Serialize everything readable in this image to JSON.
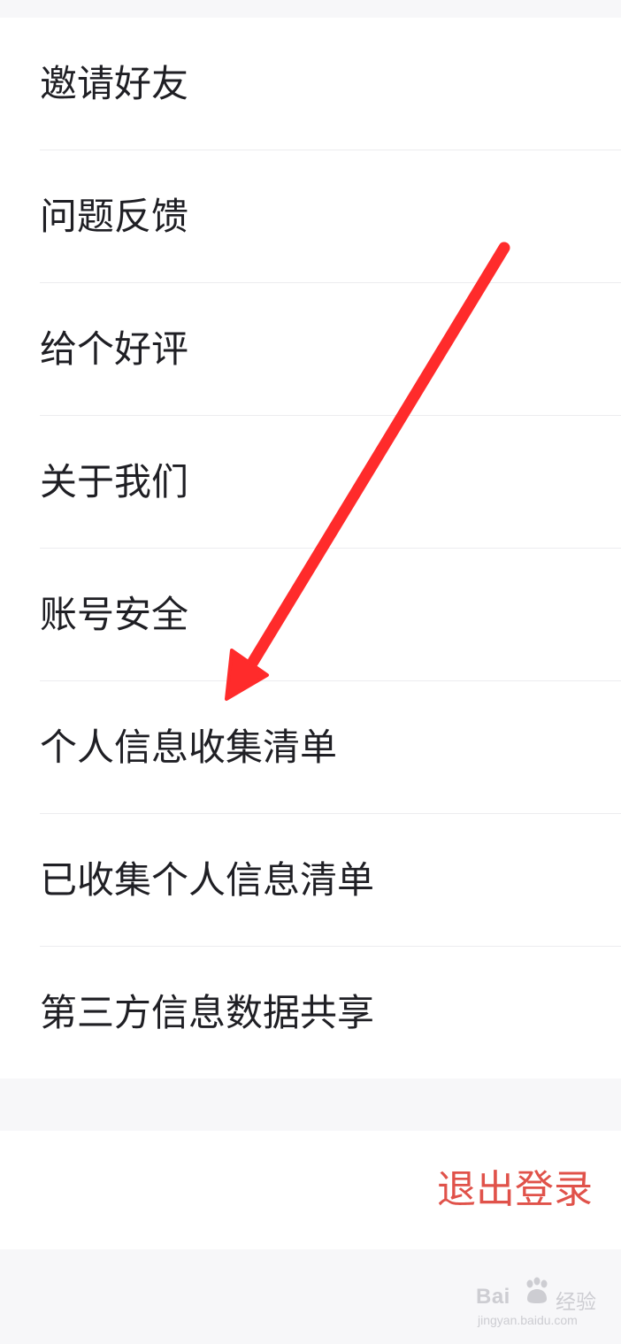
{
  "menu": {
    "items": [
      {
        "label": "邀请好友"
      },
      {
        "label": "问题反馈"
      },
      {
        "label": "给个好评"
      },
      {
        "label": "关于我们"
      },
      {
        "label": "账号安全"
      },
      {
        "label": "个人信息收集清单"
      },
      {
        "label": "已收集个人信息清单"
      },
      {
        "label": "第三方信息数据共享"
      }
    ]
  },
  "logout": {
    "label": "退出登录"
  },
  "watermark": {
    "brand": "Bai",
    "product": "经验",
    "url": "jingyan.baidu.com"
  },
  "colors": {
    "background": "#f7f7f9",
    "card": "#ffffff",
    "text": "#1f1f24",
    "divider": "#ececef",
    "logout": "#e0524a",
    "annotation_arrow": "#ff2b2b"
  }
}
